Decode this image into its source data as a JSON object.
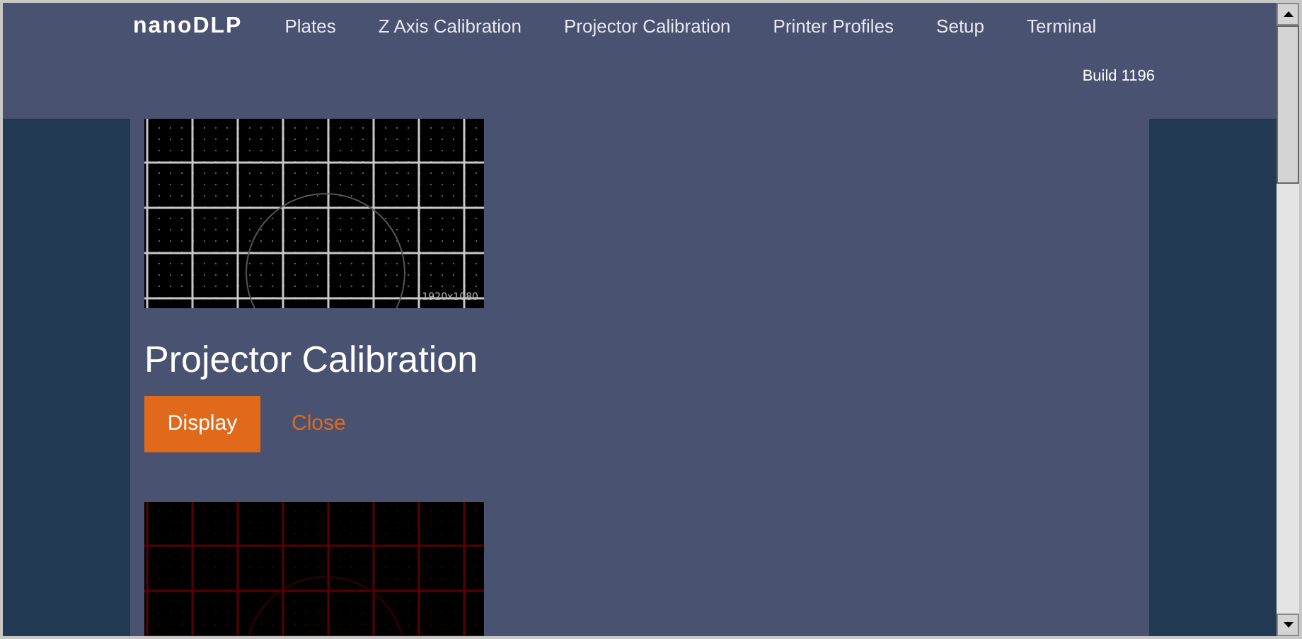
{
  "header": {
    "logo": "nanoDLP",
    "nav": [
      {
        "label": "Plates"
      },
      {
        "label": "Z Axis Calibration"
      },
      {
        "label": "Projector Calibration"
      },
      {
        "label": "Printer Profiles"
      },
      {
        "label": "Setup"
      },
      {
        "label": "Terminal"
      }
    ],
    "build": "Build 1196"
  },
  "calibration": {
    "image_label": "1920x1080",
    "title": "Projector Calibration",
    "buttons": [
      {
        "label": "Display",
        "kind": "primary"
      },
      {
        "label": "Close",
        "kind": "link"
      }
    ]
  }
}
